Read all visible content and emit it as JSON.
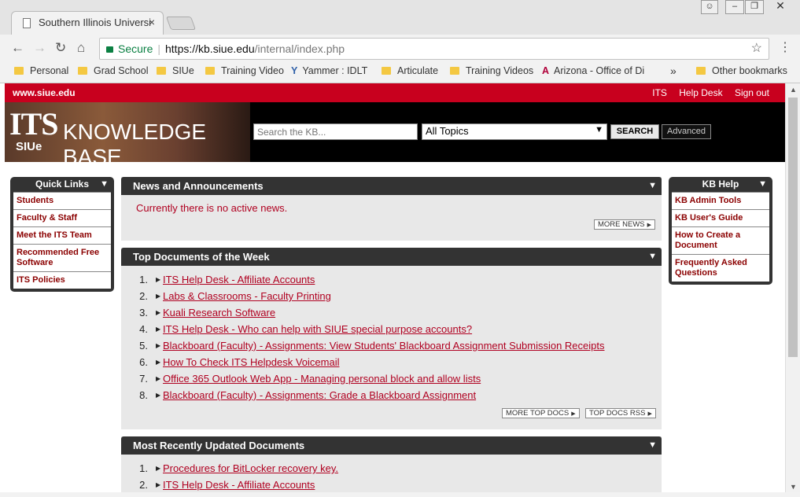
{
  "browser": {
    "tab_title": "Southern Illinois Universi",
    "tab_close": "×",
    "url_secure": "Secure",
    "url_host": "https://kb.siue.edu",
    "url_path": "/internal/index.php",
    "bookmarks": [
      "Personal",
      "Grad School",
      "SIUe",
      "Training Video",
      "Yammer : IDLT",
      "Articulate",
      "Training Videos",
      "Arizona - Office of Di"
    ],
    "bookmarks_more": "»",
    "other_bookmarks": "Other bookmarks"
  },
  "site": {
    "site_link": "www.siue.edu",
    "top_links": [
      "ITS",
      "Help Desk",
      "Sign out"
    ],
    "logo_its": "ITS",
    "logo_siue": "SIUe",
    "logo_kb": "KNOWLEDGE BASE",
    "search_placeholder": "Search the KB...",
    "topic_selected": "All Topics",
    "search_button": "SEARCH",
    "advanced_button": "Advanced"
  },
  "quick_links": {
    "title": "Quick Links",
    "items": [
      "Students",
      "Faculty & Staff",
      "Meet the ITS Team",
      "Recommended Free Software",
      "ITS Policies"
    ]
  },
  "kb_help": {
    "title": "KB Help",
    "items": [
      "KB Admin Tools",
      "KB User's Guide",
      "How to Create a Document",
      "Frequently Asked Questions"
    ]
  },
  "news": {
    "title": "News and Announcements",
    "text": "Currently there is no active news.",
    "more_button": "MORE NEWS"
  },
  "top_docs": {
    "title": "Top Documents of the Week",
    "items": [
      "ITS Help Desk - Affiliate Accounts",
      "Labs & Classrooms - Faculty Printing",
      "Kuali Research Software",
      "ITS Help Desk - Who can help with SIUE special purpose accounts?",
      "Blackboard (Faculty) - Assignments: View Students' Blackboard Assignment Submission Receipts",
      "How To Check ITS Helpdesk Voicemail",
      "Office 365 Outlook Web App - Managing personal block and allow lists",
      "Blackboard (Faculty) - Assignments: Grade a Blackboard Assignment"
    ],
    "more_button": "MORE TOP DOCS",
    "rss_button": "TOP DOCS RSS"
  },
  "recent_docs": {
    "title": "Most Recently Updated Documents",
    "items": [
      "Procedures for BitLocker recovery key.",
      "ITS Help Desk - Affiliate Accounts"
    ]
  }
}
